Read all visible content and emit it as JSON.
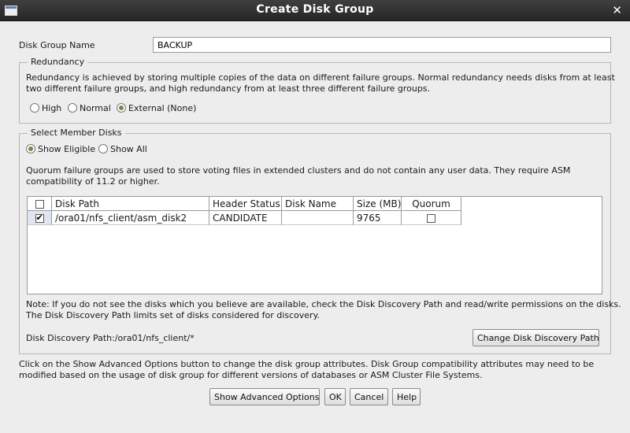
{
  "window": {
    "title": "Create Disk Group"
  },
  "name_field": {
    "label": "Disk Group Name",
    "value": "BACKUP"
  },
  "redundancy": {
    "legend": "Redundancy",
    "description_line1": "Redundancy is achieved by storing multiple copies of the data on different failure groups. Normal redundancy needs disks from at least",
    "description_line2": "two different failure groups, and high redundancy from at least three different failure groups.",
    "options": [
      {
        "label": "High",
        "selected": false
      },
      {
        "label": "Normal",
        "selected": false
      },
      {
        "label": "External (None)",
        "selected": true
      }
    ]
  },
  "member_disks": {
    "legend": "Select Member Disks",
    "filter_options": [
      {
        "label": "Show Eligible",
        "selected": true
      },
      {
        "label": "Show All",
        "selected": false
      }
    ],
    "quorum_note_line1": "Quorum failure groups are used to store voting files in extended clusters and do not contain any user data. They require ASM",
    "quorum_note_line2": "compatibility of 11.2 or higher.",
    "table": {
      "columns": [
        "Disk Path",
        "Header Status",
        "Disk Name",
        "Size (MB)",
        "Quorum"
      ],
      "rows": [
        {
          "selected": true,
          "disk_path": "/ora01/nfs_client/asm_disk2",
          "header_status": "CANDIDATE",
          "disk_name": "",
          "size_mb": "9765",
          "quorum": false
        }
      ]
    },
    "note_line1": "Note: If you do not see the disks which you believe are available, check the Disk Discovery Path and read/write permissions on the disks.",
    "note_line2": "The Disk Discovery Path limits set of disks considered for discovery.",
    "discovery_path": "Disk Discovery Path:/ora01/nfs_client/*",
    "change_path_button": "Change Disk Discovery Path"
  },
  "footer": {
    "info_line1": "Click on the Show Advanced Options button to change the disk group attributes. Disk Group compatibility attributes may need to be",
    "info_line2": "modified based on the usage of disk group for different versions of databases or ASM Cluster File Systems.",
    "buttons": {
      "advanced": "Show Advanced Options",
      "ok": "OK",
      "cancel": "Cancel",
      "help": "Help"
    }
  },
  "colors": {
    "titlebar": "#2f2f2f",
    "background": "#ededed",
    "radio_selected": "#6b8e3a"
  }
}
